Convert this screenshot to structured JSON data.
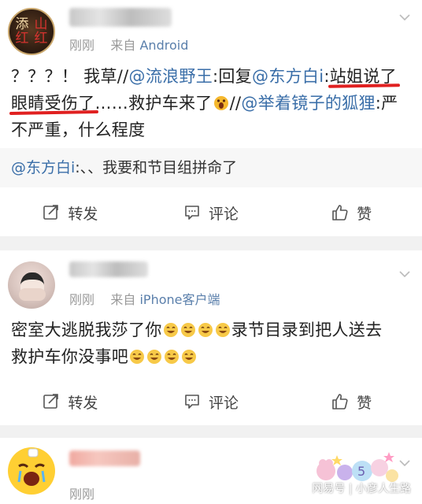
{
  "posts": [
    {
      "avatar_text": [
        "添",
        "山",
        "红",
        "红"
      ],
      "meta": {
        "time": "刚刚",
        "from_label": "来自",
        "source": "Android"
      },
      "body": {
        "p1": "？？？！ 我草//",
        "m1": "@流浪野王",
        "p2": ":回复",
        "m2": "@东方白i",
        "p3": ":",
        "u1": "站姐说了",
        "u2": "眼睛受伤了",
        "p4": "……救护车来了",
        "p5": "//",
        "m3": "@举着镜子的狐狸",
        "p6": ":严不严重，什么程度"
      },
      "quoted": {
        "mention": "@东方白i",
        "text": ":、、我要和节目组拼命了"
      },
      "actions": {
        "repost": "转发",
        "comment": "评论",
        "like": "赞"
      }
    },
    {
      "meta": {
        "time": "刚刚",
        "from_label": "来自",
        "source": "iPhone客户端"
      },
      "body": {
        "t1": "密室大逃脱我莎了你",
        "t2": "录节目录到把人送去",
        "t3": "救护车你没事吧"
      },
      "actions": {
        "repost": "转发",
        "comment": "评论",
        "like": "赞"
      }
    },
    {
      "meta": {
        "time": "刚刚"
      }
    }
  ],
  "watermark": "网易号 | 小彦人生路",
  "colors": {
    "mention": "#3a6ea8",
    "underline": "#e02020",
    "meta": "#999999",
    "source": "#5a7fab"
  },
  "icons": [
    "chevron-down-icon",
    "repost-icon",
    "comment-icon",
    "like-icon",
    "grin-emoji-icon",
    "scream-emoji-icon"
  ]
}
